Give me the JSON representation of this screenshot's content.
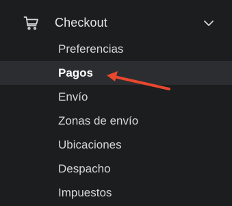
{
  "section": {
    "icon": "cart-icon",
    "label": "Checkout",
    "toggle_icon": "chevron-down-icon"
  },
  "items": [
    {
      "label": "Preferencias",
      "active": false
    },
    {
      "label": "Pagos",
      "active": true
    },
    {
      "label": "Envío",
      "active": false
    },
    {
      "label": "Zonas de envío",
      "active": false
    },
    {
      "label": "Ubicaciones",
      "active": false
    },
    {
      "label": "Despacho",
      "active": false
    },
    {
      "label": "Impuestos",
      "active": false
    }
  ],
  "annotation": {
    "icon": "arrow-left-icon",
    "color": "#e8472e"
  },
  "colors": {
    "background": "#1b1d1f",
    "active_background": "#2b2d31",
    "text": "#d7d7d7",
    "active_text": "#ffffff"
  }
}
